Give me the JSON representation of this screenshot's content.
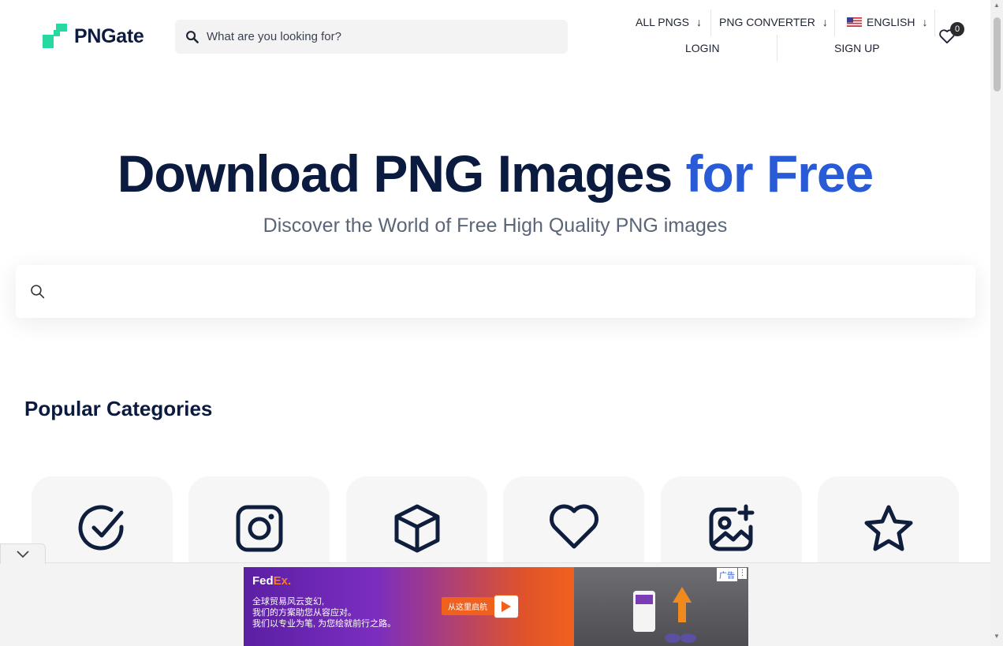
{
  "header": {
    "logo_text": "PNGate",
    "search_placeholder": "What are you looking for?",
    "nav": {
      "all_pngs": "ALL PNGS",
      "png_converter": "PNG CONVERTER",
      "language": "ENGLISH"
    },
    "login": "LOGIN",
    "signup": "SIGN UP",
    "wishlist_count": "0"
  },
  "hero": {
    "title_main": "Download PNG Images",
    "title_accent": "for Free",
    "subtitle": "Discover the World of Free High Quality PNG images"
  },
  "categories": {
    "title": "Popular Categories",
    "icons": [
      "check-circle-icon",
      "instagram-icon",
      "box-icon",
      "heart-icon",
      "image-add-icon",
      "star-icon"
    ]
  },
  "ad": {
    "brand_fed": "Fed",
    "brand_ex": "Ex.",
    "line1": "全球贸易风云变幻,",
    "line2": "我们的方案助您从容应对。",
    "line3": "我们以专业为笔, 为您绘就前行之路。",
    "cta": "从这里启航",
    "label": "广告"
  },
  "colors": {
    "accent": "#2a5bd7",
    "logo_green": "#26d9a2",
    "heading": "#0b1a3f"
  }
}
